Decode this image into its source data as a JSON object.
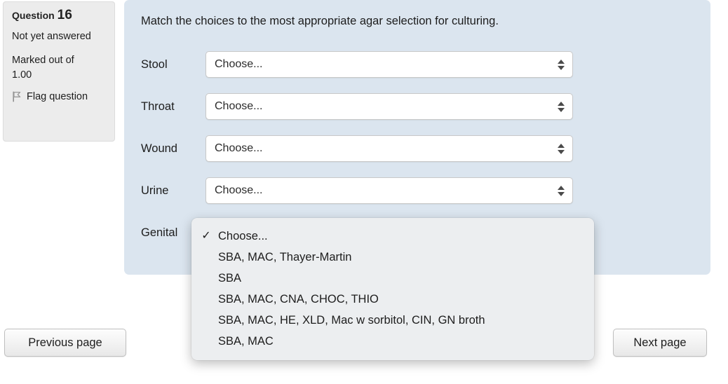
{
  "question_info": {
    "heading_label": "Question",
    "number": "16",
    "status": "Not yet answered",
    "marks": "Marked out of 1.00",
    "flag_label": "Flag question",
    "flag_icon": "flag-icon"
  },
  "question": {
    "prompt": "Match the choices to the most appropriate agar selection for culturing.",
    "rows": [
      {
        "label": "Stool",
        "value": "Choose..."
      },
      {
        "label": "Throat",
        "value": "Choose..."
      },
      {
        "label": "Wound",
        "value": "Choose..."
      },
      {
        "label": "Urine",
        "value": "Choose..."
      },
      {
        "label": "Genital",
        "value": "Choose..."
      }
    ],
    "select_arrows_icon": "sort-updown-icon"
  },
  "dropdown": {
    "open_for_row": "Genital",
    "selected_index": 0,
    "check_glyph": "✓",
    "options": [
      "Choose...",
      "SBA, MAC, Thayer-Martin",
      "SBA",
      "SBA, MAC, CNA, CHOC, THIO",
      "SBA, MAC, HE, XLD, Mac w sorbitol, CIN, GN broth",
      "SBA, MAC"
    ]
  },
  "navigation": {
    "previous_label": "Previous page",
    "next_label": "Next page"
  },
  "colors": {
    "panel_background": "#dbe5ef",
    "info_background": "#ececec",
    "page_background": "#ffffff",
    "dropdown_background": "#eceef0",
    "text": "#1d1d1d"
  }
}
